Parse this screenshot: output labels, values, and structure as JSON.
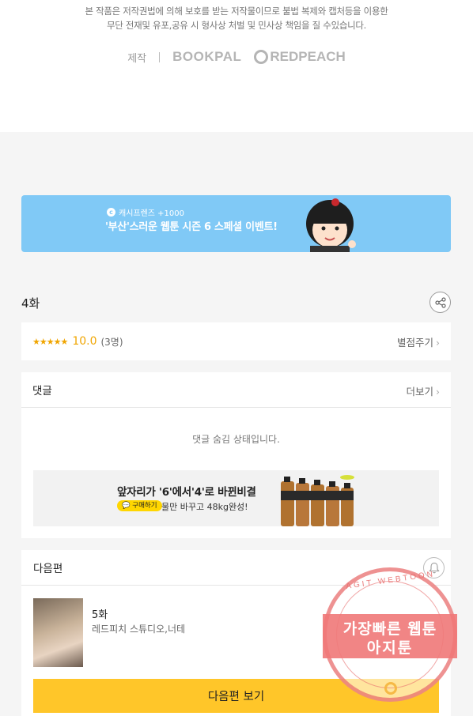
{
  "copyright": {
    "line1": "본 작품은 저작권법에 의해 보호를 받는 저작물이므로 불법 복제와 캡처등을 이용한",
    "line2": "무단 전재및 유포,공유 시 형사상 처벌 및 민사상 책임을 질 수있습니다.",
    "produced_by_label": "제작",
    "publishers": [
      "BOOKPAL",
      "REDPEACH"
    ]
  },
  "banner": {
    "sub": "캐시프렌즈 +1000",
    "title": "'부산'스러운 웹툰 시즌 6 스페셜 이벤트!",
    "accent": "#80c9f6"
  },
  "episode": {
    "title": "4화",
    "share_icon": "share-icon"
  },
  "rating": {
    "stars": "★★★★★",
    "score": "10.0",
    "count": "(3명)",
    "rate_link": "별점주기"
  },
  "comments": {
    "title": "댓글",
    "more": "더보기",
    "hidden_message": "댓글 숨김 상태입니다."
  },
  "ad": {
    "title": "앞자리가 '6'에서'4'로 바뀐비결",
    "buy_label": "구매하기",
    "desc": "물만 바꾸고 48kg완성!"
  },
  "next": {
    "title": "다음편",
    "episode_name": "5화",
    "author": "레드피치 스튜디오,너테",
    "button": "다음편 보기",
    "button_color": "#ffc629"
  },
  "watermark": {
    "arc": "AGIT WEBTOON",
    "line1": "가장빠른 웹툰",
    "line2": "아지툰"
  }
}
